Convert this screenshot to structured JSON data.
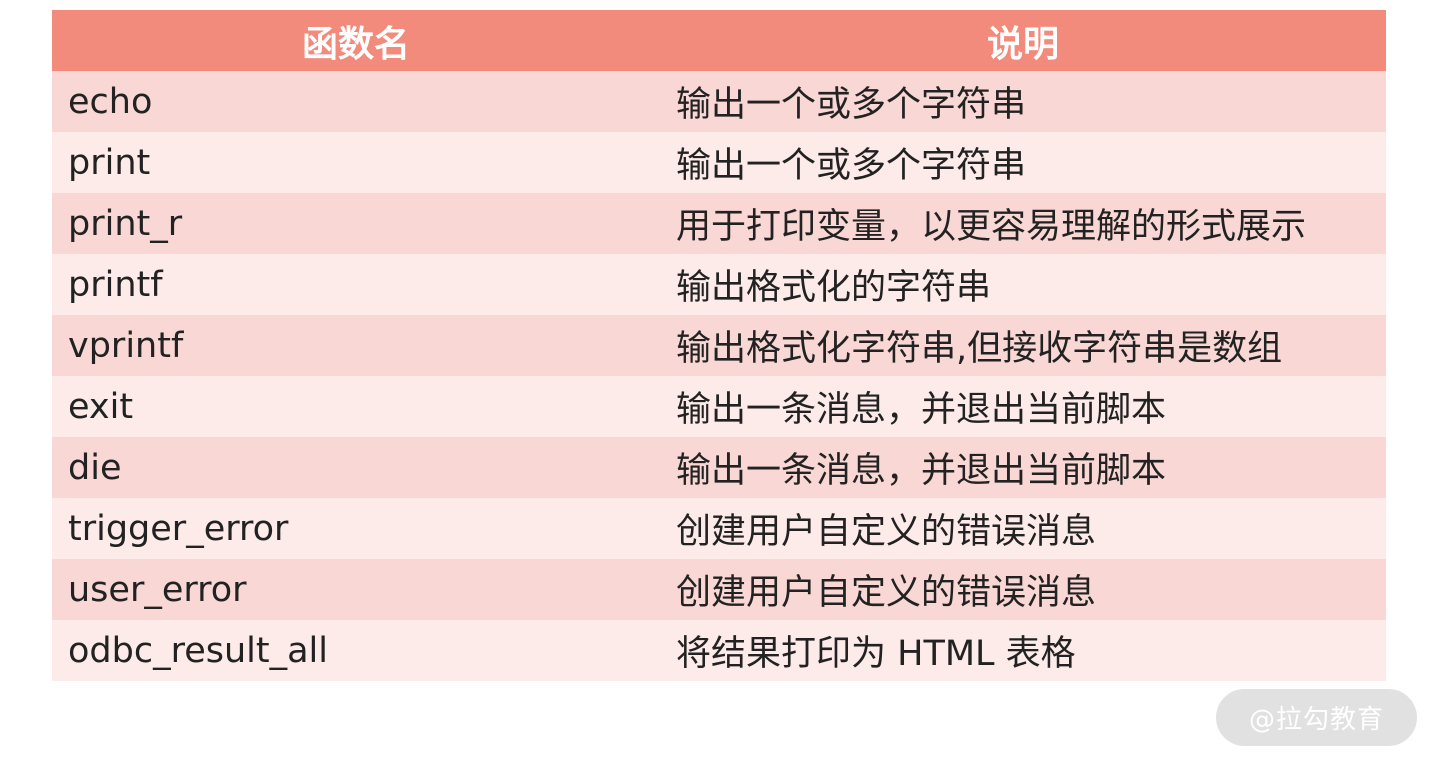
{
  "table": {
    "headers": [
      "函数名",
      "说明"
    ],
    "rows": [
      {
        "name": "echo",
        "desc": "输出一个或多个字符串"
      },
      {
        "name": "print",
        "desc": "输出一个或多个字符串"
      },
      {
        "name": "print_r",
        "desc": "用于打印变量，以更容易理解的形式展示"
      },
      {
        "name": "printf",
        "desc": "输出格式化的字符串"
      },
      {
        "name": "vprintf",
        "desc": "输出格式化字符串,但接收字符串是数组"
      },
      {
        "name": "exit",
        "desc": "输出一条消息，并退出当前脚本"
      },
      {
        "name": "die",
        "desc": "输出一条消息，并退出当前脚本"
      },
      {
        "name": "trigger_error",
        "desc": "创建用户自定义的错误消息"
      },
      {
        "name": "user_error",
        "desc": "创建用户自定义的错误消息"
      },
      {
        "name": "odbc_result_all",
        "desc": "将结果打印为 HTML 表格"
      }
    ]
  },
  "watermark": {
    "text": "@拉勾教育"
  },
  "colors": {
    "header_bg": "#f28b7c",
    "row_odd_bg": "#f8d7d4",
    "row_even_bg": "#fcebe9"
  }
}
